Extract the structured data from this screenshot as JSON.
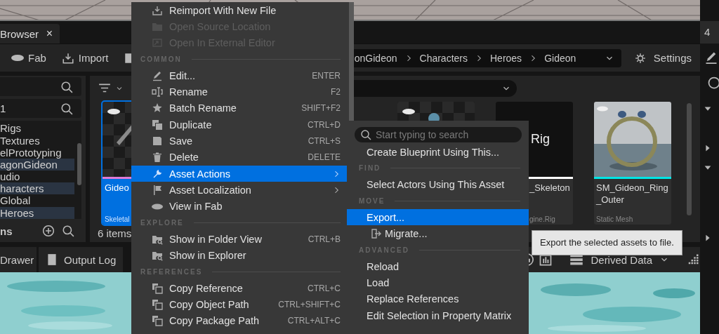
{
  "tab": {
    "label": "Browser",
    "close": "×"
  },
  "toolbar": {
    "buttons": [
      "Fab",
      "Import"
    ],
    "breadcrumb": [
      "onGideon",
      "Characters",
      "Heroes",
      "Gideon"
    ],
    "settings": "Settings"
  },
  "sidebar": {
    "filter_value": "1",
    "tree": [
      {
        "label": "Rigs",
        "selected": false
      },
      {
        "label": "Textures",
        "selected": false
      },
      {
        "label": "elPrototyping",
        "selected": false
      },
      {
        "label": "agonGideon",
        "selected": true
      },
      {
        "label": "udio",
        "selected": false
      },
      {
        "label": "haracters",
        "selected": true
      },
      {
        "label": "Global",
        "selected": false
      },
      {
        "label": "Heroes",
        "selected": true
      }
    ],
    "footer": "ns"
  },
  "assets": {
    "tiles": [
      {
        "kind": "checker",
        "name": "Gideo",
        "type": "Skeletal",
        "selected": true,
        "color": "#e07ad6"
      },
      {
        "kind": "figure",
        "selected": false
      },
      {
        "kind": "text",
        "thumb_text": "Rig",
        "name": "_Skeleton",
        "type": "gine.Rig",
        "selected": false,
        "color": "#ffffff"
      },
      {
        "kind": "picture",
        "name": "SM_Gideon_Ring_Outer",
        "type": "Static Mesh",
        "selected": false,
        "color": "#00e5e5"
      }
    ],
    "count": "6 items"
  },
  "bottom_bar": {
    "tabs": [
      "Drawer",
      "Output Log"
    ],
    "derived_data": "Derived Data"
  },
  "right_panel": {
    "tab": "4"
  },
  "context_menu": {
    "items": [
      {
        "kind": "item",
        "label": "Reimport With New File",
        "disabled": false,
        "submenu": false,
        "selected": false
      },
      {
        "kind": "item",
        "label": "Open Source Location",
        "disabled": true,
        "submenu": false,
        "selected": false
      },
      {
        "kind": "item",
        "label": "Open In External Editor",
        "disabled": true,
        "submenu": false,
        "selected": false
      },
      {
        "kind": "section",
        "label": "COMMON"
      },
      {
        "kind": "item",
        "label": "Edit...",
        "shortcut": "ENTER",
        "disabled": false,
        "submenu": false,
        "selected": false
      },
      {
        "kind": "item",
        "label": "Rename",
        "shortcut": "F2",
        "disabled": false,
        "submenu": false,
        "selected": false
      },
      {
        "kind": "item",
        "label": "Batch Rename",
        "shortcut": "SHIFT+F2",
        "disabled": false,
        "submenu": false,
        "selected": false
      },
      {
        "kind": "item",
        "label": "Duplicate",
        "shortcut": "CTRL+D",
        "disabled": false,
        "submenu": false,
        "selected": false
      },
      {
        "kind": "item",
        "label": "Save",
        "shortcut": "CTRL+S",
        "disabled": false,
        "submenu": false,
        "selected": false
      },
      {
        "kind": "item",
        "label": "Delete",
        "shortcut": "DELETE",
        "disabled": false,
        "submenu": false,
        "selected": false
      },
      {
        "kind": "item",
        "label": "Asset Actions",
        "disabled": false,
        "submenu": true,
        "selected": true
      },
      {
        "kind": "item",
        "label": "Asset Localization",
        "disabled": false,
        "submenu": true,
        "selected": false
      },
      {
        "kind": "item",
        "label": "View in Fab",
        "disabled": false,
        "submenu": false,
        "selected": false
      },
      {
        "kind": "section",
        "label": "EXPLORE"
      },
      {
        "kind": "item",
        "label": "Show in Folder View",
        "shortcut": "CTRL+B",
        "disabled": false,
        "submenu": false,
        "selected": false
      },
      {
        "kind": "item",
        "label": "Show in Explorer",
        "disabled": false,
        "submenu": false,
        "selected": false
      },
      {
        "kind": "section",
        "label": "REFERENCES"
      },
      {
        "kind": "item",
        "label": "Copy Reference",
        "shortcut": "CTRL+C",
        "disabled": false,
        "submenu": false,
        "selected": false
      },
      {
        "kind": "item",
        "label": "Copy Object Path",
        "shortcut": "CTRL+SHIFT+C",
        "disabled": false,
        "submenu": false,
        "selected": false
      },
      {
        "kind": "item",
        "label": "Copy Package Path",
        "shortcut": "CTRL+ALT+C",
        "disabled": false,
        "submenu": false,
        "selected": false
      }
    ]
  },
  "submenu": {
    "search": {
      "placeholder": "Start typing to search"
    },
    "items": [
      {
        "kind": "item",
        "label": "Create Blueprint Using This...",
        "selected": false
      },
      {
        "kind": "section",
        "label": "FIND"
      },
      {
        "kind": "item",
        "label": "Select Actors Using This Asset",
        "selected": false
      },
      {
        "kind": "section",
        "label": "MOVE"
      },
      {
        "kind": "item",
        "label": "Export...",
        "selected": true
      },
      {
        "kind": "item",
        "label": "Migrate...",
        "selected": false
      },
      {
        "kind": "section",
        "label": "ADVANCED"
      },
      {
        "kind": "item",
        "label": "Reload",
        "selected": false
      },
      {
        "kind": "item",
        "label": "Load",
        "selected": false
      },
      {
        "kind": "item",
        "label": "Replace References",
        "selected": false
      },
      {
        "kind": "item",
        "label": "Edit Selection in Property Matrix",
        "selected": false
      }
    ]
  },
  "tooltip": "Export the selected assets to file."
}
